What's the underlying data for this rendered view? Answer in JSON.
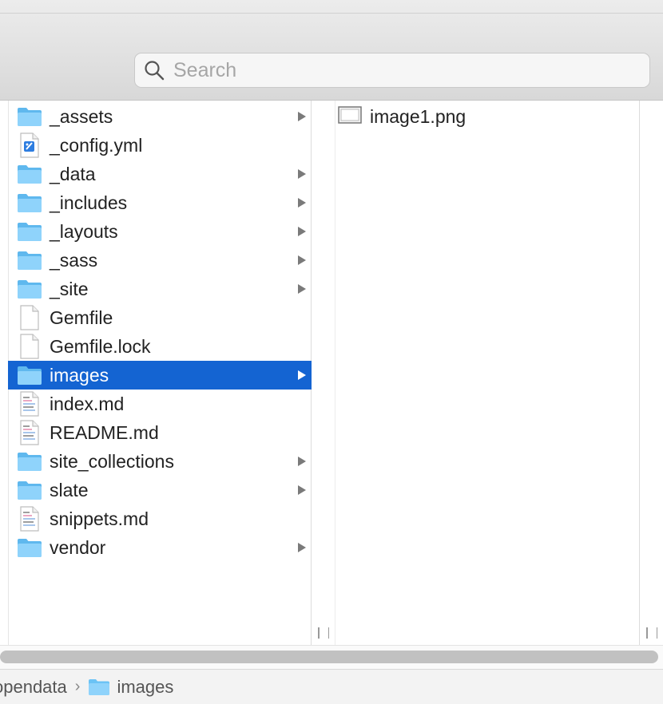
{
  "search": {
    "placeholder": "Search"
  },
  "column1": {
    "items": [
      {
        "label": "_assets",
        "type": "folder",
        "has_children": true
      },
      {
        "label": "_config.yml",
        "type": "yml"
      },
      {
        "label": "_data",
        "type": "folder",
        "has_children": true
      },
      {
        "label": "_includes",
        "type": "folder",
        "has_children": true
      },
      {
        "label": "_layouts",
        "type": "folder",
        "has_children": true
      },
      {
        "label": "_sass",
        "type": "folder",
        "has_children": true
      },
      {
        "label": "_site",
        "type": "folder",
        "has_children": true
      },
      {
        "label": "Gemfile",
        "type": "file"
      },
      {
        "label": "Gemfile.lock",
        "type": "file"
      },
      {
        "label": "images",
        "type": "folder",
        "has_children": true,
        "selected": true
      },
      {
        "label": "index.md",
        "type": "markdown"
      },
      {
        "label": "README.md",
        "type": "markdown"
      },
      {
        "label": "site_collections",
        "type": "folder",
        "has_children": true
      },
      {
        "label": "slate",
        "type": "folder",
        "has_children": true
      },
      {
        "label": "snippets.md",
        "type": "markdown"
      },
      {
        "label": "vendor",
        "type": "folder",
        "has_children": true
      }
    ]
  },
  "column2": {
    "items": [
      {
        "label": "image1.png",
        "type": "image"
      }
    ]
  },
  "pathbar": {
    "parent": "opendata",
    "current": "images"
  },
  "colors": {
    "selection": "#1464d2",
    "folder": "#6bc3f5"
  }
}
